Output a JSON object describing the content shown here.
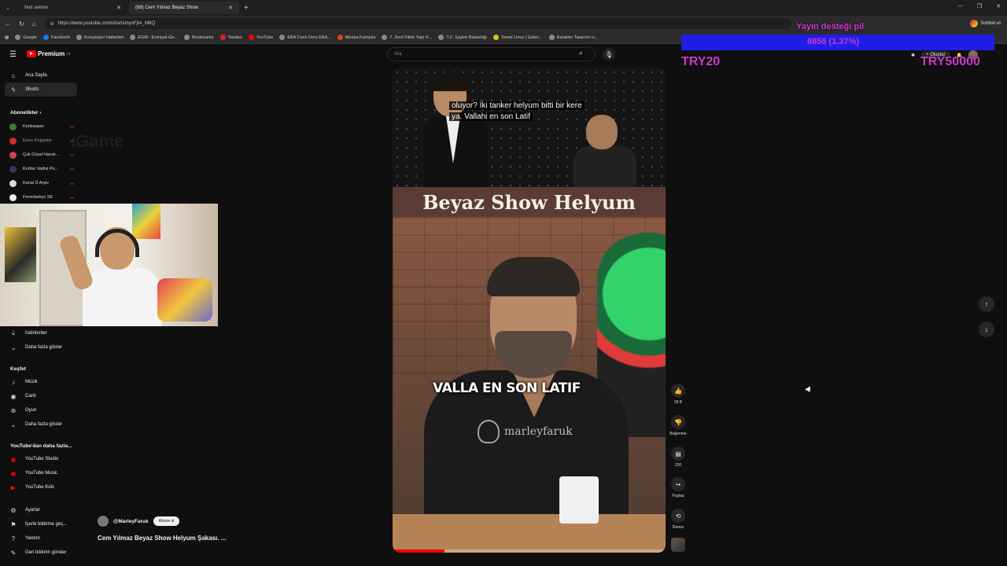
{
  "browser": {
    "tabs": [
      {
        "label": "Yeni sekme",
        "active": false
      },
      {
        "label": "(68) Cem Yılmaz Beyaz Show",
        "active": true
      }
    ],
    "url": "https://www.youtube.com/shorts/nyoFjIA_M6Q",
    "profile_label": "Sohbet et",
    "bookmarks": [
      "Google",
      "Facebook",
      "Konyaspor Haberleri",
      "EGM - Emniyet Ge...",
      "Bookmarks",
      "Yandex",
      "YouTube",
      "EBA Canlı Ders EBA...",
      "Meripa Kampüs",
      "7. Sınıf Fiilde Yapı K...",
      "T.C. İçişleri Bakanlığı",
      "Temel Linux | Gelec...",
      "Karakter Tasarımı v..."
    ]
  },
  "youtube": {
    "logo": "Premium",
    "logo_sup": "TR",
    "search_placeholder": "Ara",
    "create_label": "Oluştur"
  },
  "sidebar": {
    "main": [
      {
        "label": "Ana Sayfa",
        "icon": "home-icon"
      },
      {
        "label": "Shorts",
        "icon": "shorts-icon"
      }
    ],
    "subs_header": "Abonelikler",
    "subscriptions": [
      "Kontraspor",
      "Emre Doğanlar",
      "Çok Güzel Harek...",
      "Kurtlar Vadisi Pu...",
      "Kanal D Arşiv",
      "Fenerbahçe SK"
    ],
    "you_items": [
      {
        "label": "İndirilenler",
        "icon": "download-icon"
      },
      {
        "label": "Daha fazla göster",
        "icon": "chevron-down-icon"
      }
    ],
    "explore_header": "Keşfet",
    "explore": [
      {
        "label": "Müzik",
        "icon": "music-icon"
      },
      {
        "label": "Canlı",
        "icon": "live-icon"
      },
      {
        "label": "Oyun",
        "icon": "gaming-icon"
      },
      {
        "label": "Daha fazla göster",
        "icon": "chevron-down-icon"
      }
    ],
    "more_header": "YouTube'dan daha fazla...",
    "more": [
      "YouTube Studio",
      "YouTube Music",
      "YouTube Kids"
    ],
    "settings": [
      {
        "label": "Ayarlar",
        "icon": "gear-icon"
      },
      {
        "label": "İçerik bildirme geç...",
        "icon": "flag-icon"
      },
      {
        "label": "Yardım",
        "icon": "help-icon"
      },
      {
        "label": "Geri bildirim gönder",
        "icon": "feedback-icon"
      }
    ]
  },
  "overlay": {
    "game_text": "ıGame",
    "donation_label": "Yayın desteği pil",
    "donation_value": "6856 (1.37%)",
    "goal_left": "TRY20",
    "goal_right": "TRY50000"
  },
  "short": {
    "subtitle_line1": "oluyor? İki tanker helyum bitti bir kere",
    "subtitle_line2": "ya. Vallahi en son Latif",
    "title_banner": "Beyaz Show Helyum",
    "caption": "VALLA EN SON LATIF",
    "watermark": "marleyfaruk",
    "progress": 0.19,
    "channel": "@MarleyFaruk",
    "subscribe_label": "Abone ol",
    "video_title": "Cem Yılmaz Beyaz Show Helyum Şakası. ..."
  },
  "actions": {
    "likes": "39 B",
    "dislike_label": "Beğenme",
    "comments": "220",
    "share_label": "Paylaş",
    "remix_label": "Remix"
  },
  "colors": {
    "yt_red": "#ff0000",
    "overlay_magenta": "#d03ad0",
    "overlay_blue": "#1e1ee8"
  }
}
